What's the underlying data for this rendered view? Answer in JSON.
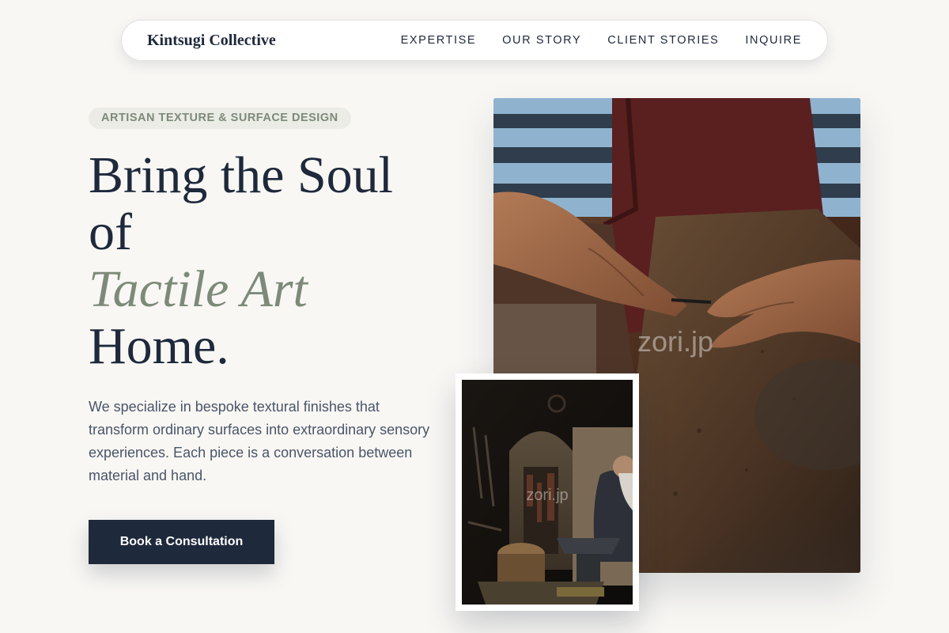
{
  "nav": {
    "brand": "Kintsugi Collective",
    "links": [
      "EXPERTISE",
      "OUR STORY",
      "CLIENT STORIES",
      "INQUIRE"
    ]
  },
  "hero": {
    "eyebrow": "ARTISAN TEXTURE & SURFACE DESIGN",
    "headline_line1": "Bring the Soul",
    "headline_line2": "of",
    "headline_accent": "Tactile Art",
    "headline_line3": "Home.",
    "lede": "We specialize in bespoke textural finishes that transform ordinary surfaces into extraordinary sensory experiences. Each piece is a conversation between material and hand.",
    "cta_label": "Book a Consultation"
  },
  "images": {
    "main_watermark": "zori.jp",
    "small_watermark": "zori.jp"
  },
  "colors": {
    "background": "#f8f7f4",
    "navy": "#1e293b",
    "sage": "#7d8a79",
    "body_text": "#4a5568"
  }
}
